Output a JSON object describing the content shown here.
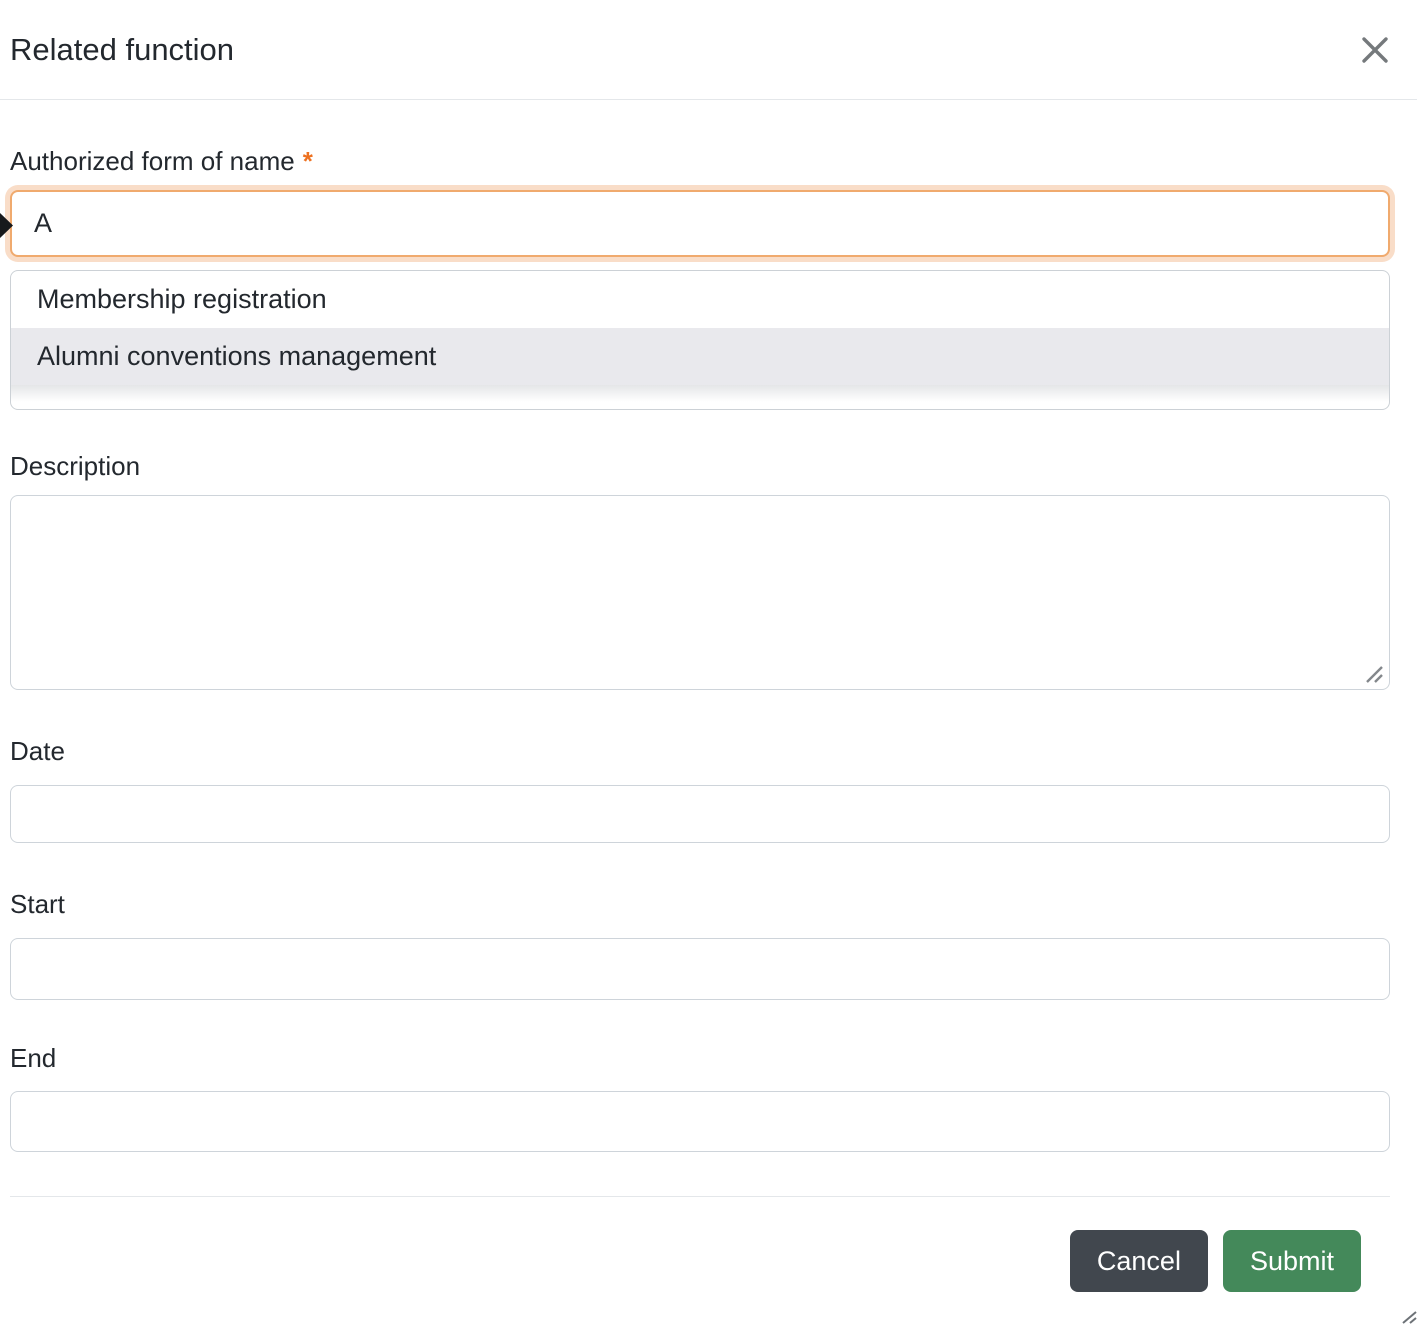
{
  "dialog": {
    "title": "Related function"
  },
  "form": {
    "authorized_form": {
      "label": "Authorized form of name",
      "required_marker": "*",
      "value": "A"
    },
    "autocomplete": {
      "options": [
        {
          "label": "Membership registration",
          "highlighted": false
        },
        {
          "label": "Alumni conventions management",
          "highlighted": true
        }
      ]
    },
    "description": {
      "label": "Description",
      "value": ""
    },
    "date": {
      "label": "Date",
      "value": ""
    },
    "start": {
      "label": "Start",
      "value": ""
    },
    "end": {
      "label": "End",
      "value": ""
    }
  },
  "footer": {
    "cancel_label": "Cancel",
    "submit_label": "Submit"
  },
  "icons": {
    "close": "✕",
    "cursor": "mouse-arrow",
    "textarea_resize": "diagonal-grip",
    "window_resize": "corner-grip"
  },
  "colors": {
    "accent_orange": "#ed7120",
    "focus_border": "#f0aa6e",
    "focus_glow": "#f9ddc8",
    "option_highlight": "#e9e9ed",
    "input_border": "#ced4da",
    "divider": "#e4e7ea",
    "cancel_dark": "#41474e",
    "submit_green": "#44895a",
    "text_dark": "#23282e",
    "icon_gray": "#75797c"
  }
}
